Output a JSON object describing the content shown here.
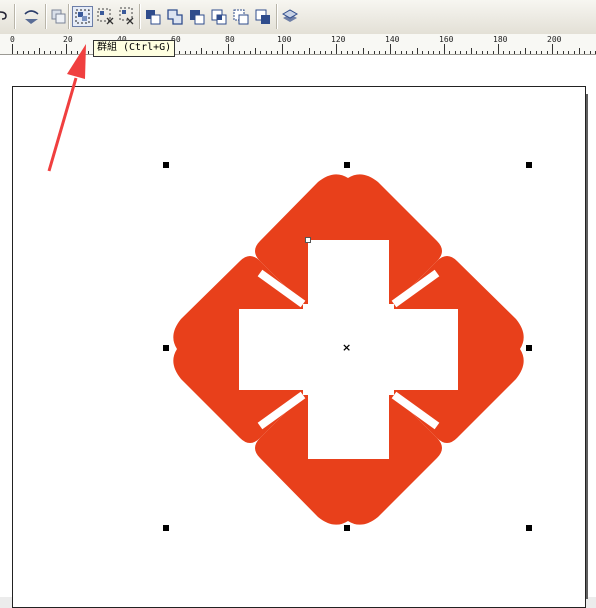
{
  "toolbar": {
    "buttons": [
      {
        "name": "partial-tool-button",
        "icon": "curve-tool-icon"
      },
      {
        "name": "flip-tool-button",
        "icon": "flip-icon"
      },
      {
        "name": "copy-properties-button",
        "icon": "copy-icon"
      },
      {
        "name": "group-button",
        "icon": "group-icon",
        "active": true
      },
      {
        "name": "ungroup-button",
        "icon": "ungroup-icon"
      },
      {
        "name": "ungroup-all-button",
        "icon": "ungroup-all-icon"
      },
      {
        "name": "combine-button",
        "icon": "combine-icon"
      },
      {
        "name": "weld-button",
        "icon": "weld-icon"
      },
      {
        "name": "trim-button",
        "icon": "trim-icon"
      },
      {
        "name": "intersect-button",
        "icon": "intersect-icon"
      },
      {
        "name": "simplify-button",
        "icon": "simplify-icon"
      },
      {
        "name": "front-minus-back-button",
        "icon": "front-minus-back-icon"
      },
      {
        "name": "order-button",
        "icon": "order-icon"
      }
    ]
  },
  "tooltip": {
    "text": "群組 (Ctrl+G)"
  },
  "ruler": {
    "labels": [
      "0",
      "20",
      "40",
      "60",
      "80",
      "100",
      "120",
      "140",
      "160",
      "180",
      "200"
    ]
  },
  "colors": {
    "shape": "#e8401b",
    "arrow": "#f03f3f",
    "page": "#ffffff"
  },
  "canvas": {
    "center_marker": "×"
  }
}
